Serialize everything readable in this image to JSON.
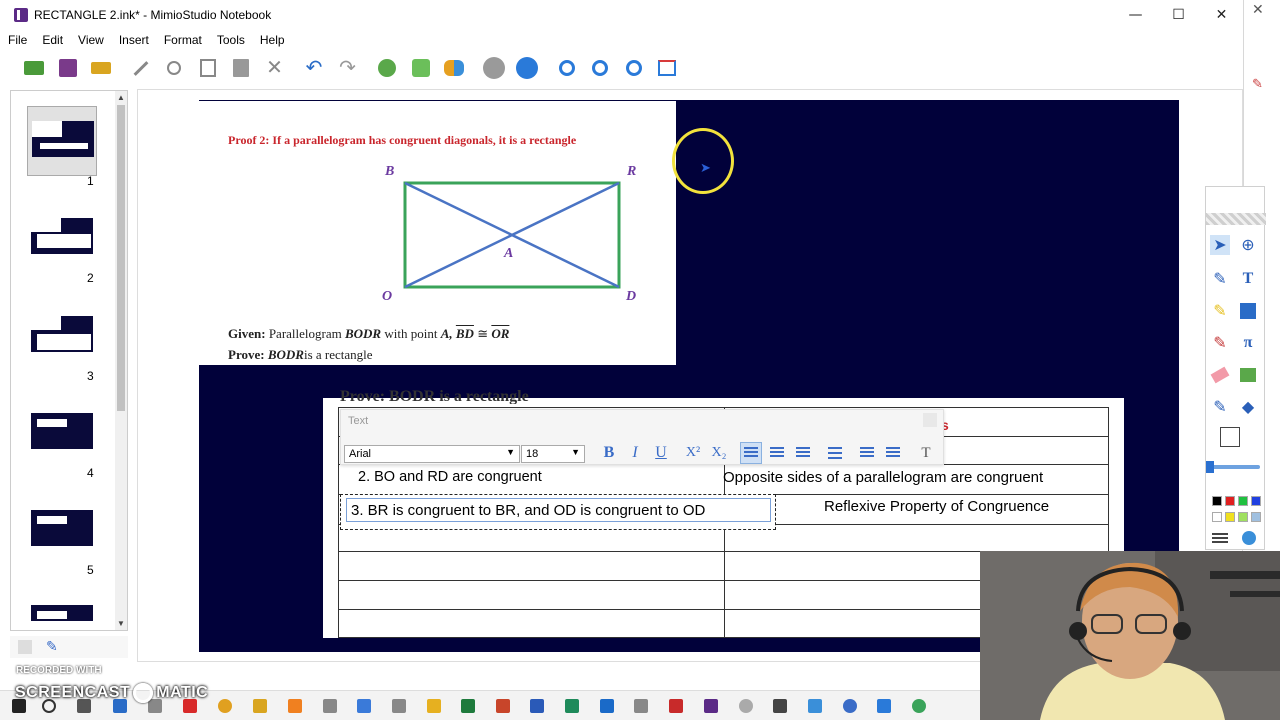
{
  "window": {
    "title": "RECTANGLE 2.ink* - MimioStudio Notebook",
    "controls": {
      "minimize": "—",
      "maximize": "☐",
      "close": "✕"
    }
  },
  "menu": [
    "File",
    "Edit",
    "View",
    "Insert",
    "Format",
    "Tools",
    "Help"
  ],
  "toolbar_icons": [
    "import-icon",
    "save-icon",
    "print-icon",
    "recognize-icon",
    "cut-icon",
    "copy-icon",
    "paste-icon",
    "delete-icon",
    "undo-icon",
    "redo-icon",
    "add-page-icon",
    "add-object-icon",
    "collaborate-icon",
    "back-icon",
    "forward-icon",
    "zoom-in-icon",
    "zoom-out-icon",
    "zoom-fit-icon",
    "screen-capture-icon"
  ],
  "slides": [
    {
      "num": "1",
      "selected": true
    },
    {
      "num": "2",
      "selected": false
    },
    {
      "num": "3",
      "selected": false
    },
    {
      "num": "4",
      "selected": false
    },
    {
      "num": "5",
      "selected": false
    }
  ],
  "proof": {
    "title": "Proof 2:  If a parallelogram has congruent diagonals, it is a rectangle",
    "vertices": {
      "B": "B",
      "R": "R",
      "O": "O",
      "D": "D",
      "A": "A"
    },
    "given_label": "Given:",
    "given_text": " Parallelogram ",
    "given_fig": "BODR",
    "given_mid": " with point ",
    "given_point": "A",
    "given_seg1": "BD",
    "given_cong": " ≅ ",
    "given_seg2": "OR",
    "prove_label": "Prove:",
    "prove_fig": "BODR",
    "prove_text": "is a rectangle"
  },
  "peek_text": "Prove: BODR is a rectangle",
  "text_toolbar": {
    "title": "Text",
    "font": "Arial",
    "size": "18",
    "buttons": {
      "bold": "B",
      "italic": "I",
      "underline": "U",
      "sup": "X²",
      "sub": "X₂"
    }
  },
  "table": {
    "row2_left": "2. BO and RD are congruent",
    "row2_right": "Opposite sides of a parallelogram are congruent",
    "row3_left": "3. BR is congruent to BR, and OD is congruent to OD",
    "row3_right": "Reflexive Property of Congruence",
    "header_peek": "s"
  },
  "watermark": {
    "line1": "RECORDED WITH",
    "line2": "SCREENCAST",
    "line3": "MATIC"
  },
  "colors": {
    "slide_bg": "#01013a",
    "title_red": "#c9252c",
    "vertex_purple": "#6b3aa0",
    "rect_green": "#3aa35a",
    "diag_blue": "#4a74c4",
    "ring_yellow": "#f2e23c"
  }
}
